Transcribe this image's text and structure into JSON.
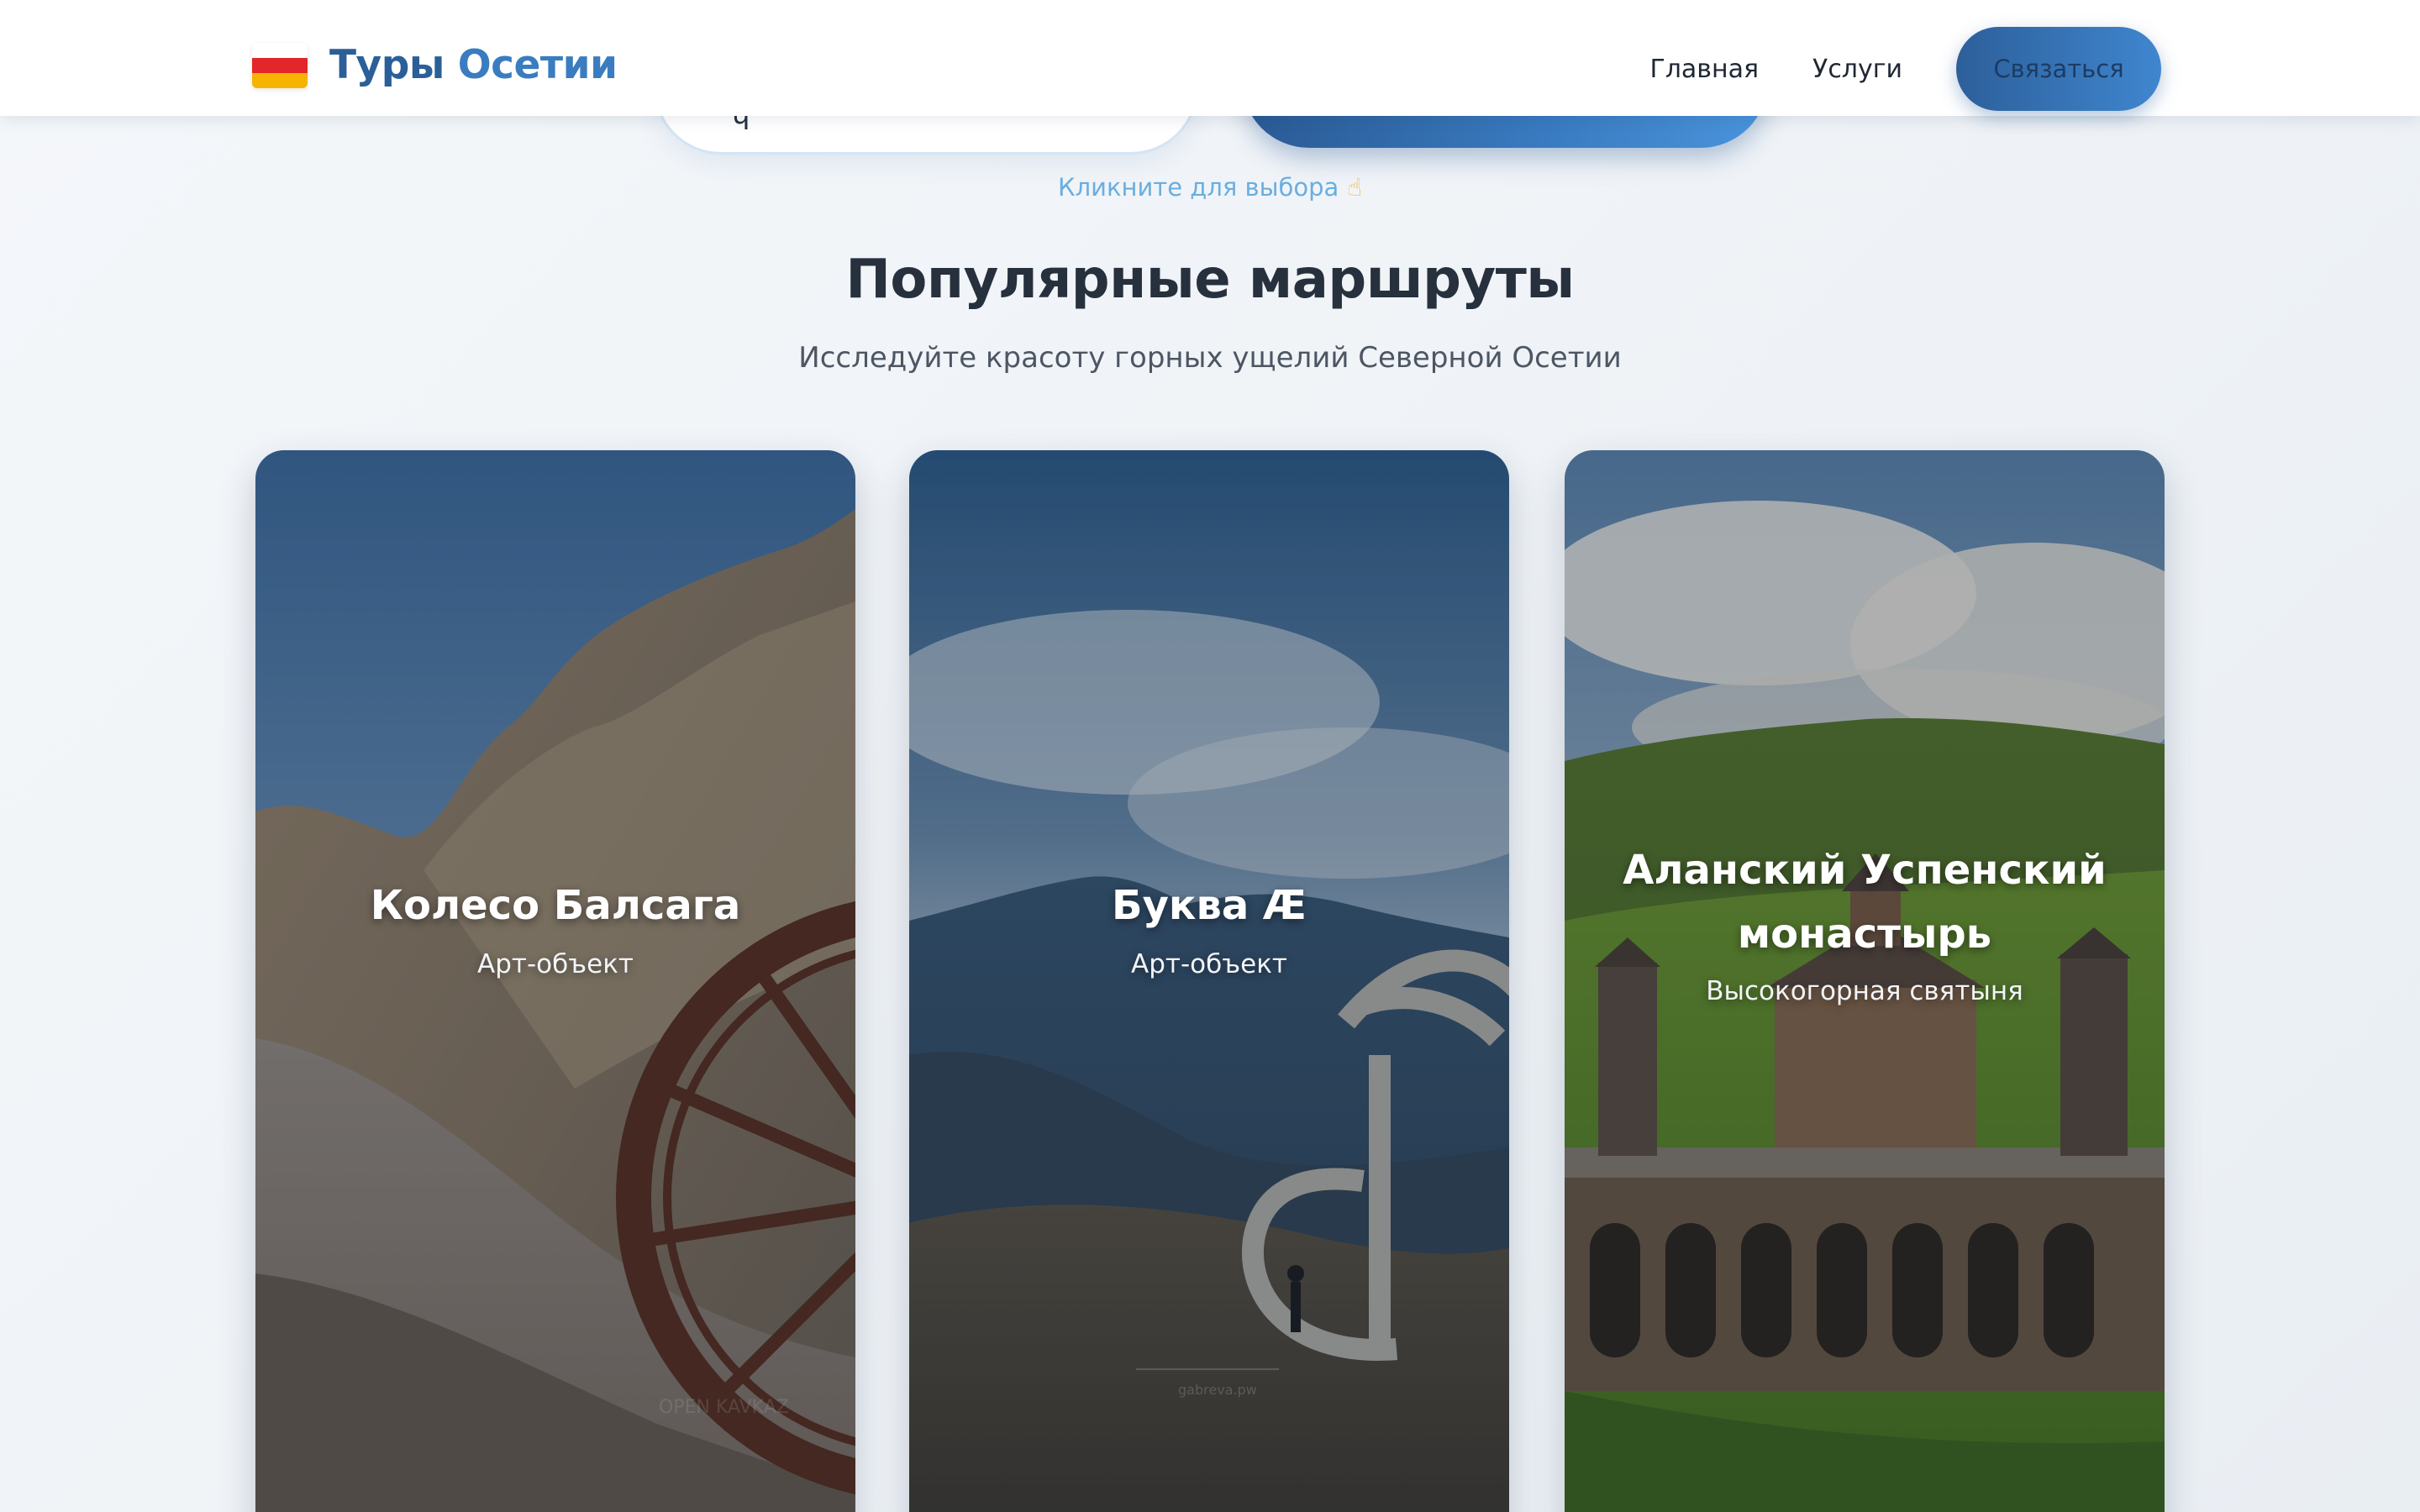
{
  "header": {
    "logo_word1": "Туры",
    "logo_word2": "Осетии",
    "nav": [
      "Главная",
      "Услуги"
    ],
    "contact_button": "Связаться"
  },
  "hint": {
    "text": "Кликните для выбора",
    "icon": "pointing-hand-icon"
  },
  "section": {
    "title": "Популярные маршруты",
    "subtitle": "Исследуйте красоту горных ущелий Северной Осетии"
  },
  "cards": [
    {
      "title": "Колесо Балсага",
      "subtitle": "Арт-объект",
      "watermark": "OPEN KAVKAZ"
    },
    {
      "title": "Буква Æ",
      "subtitle": "Арт-объект",
      "watermark": "gabreva.pw"
    },
    {
      "title": "Аланский Успенский монастырь",
      "subtitle": "Высокогорная святыня"
    }
  ],
  "colors": {
    "brand_dark": "#2b5f98",
    "brand_light": "#3a7cc0",
    "flag_white": "#ffffff",
    "flag_red": "#e3262a",
    "flag_yellow": "#f5b400"
  }
}
